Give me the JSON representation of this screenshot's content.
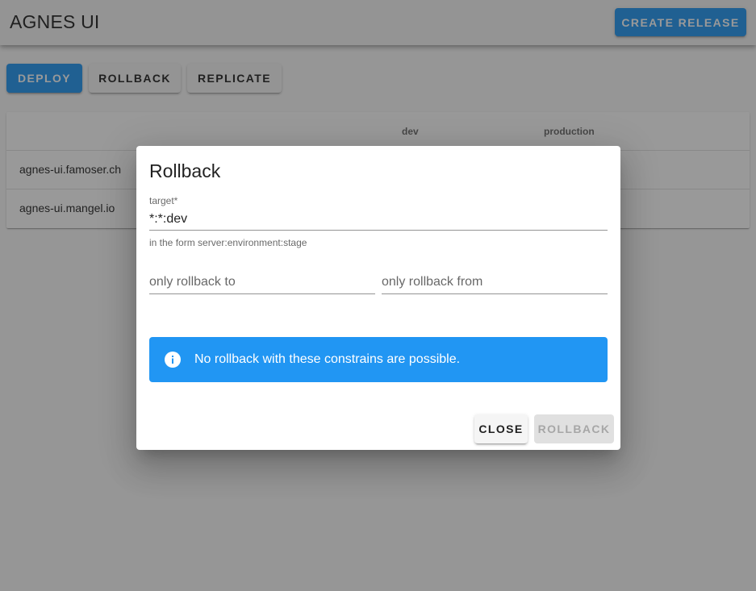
{
  "app": {
    "title": "AGNES UI",
    "create_release_label": "Create Release"
  },
  "actions": {
    "deploy_label": "Deploy",
    "rollback_label": "Rollback",
    "replicate_label": "Replicate"
  },
  "table": {
    "columns": [
      "",
      "dev",
      "production"
    ],
    "rows": [
      {
        "name": "agnes-ui.famoser.ch"
      },
      {
        "name": "agnes-ui.mangel.io"
      }
    ]
  },
  "dialog": {
    "title": "Rollback",
    "target": {
      "label": "target*",
      "value": "*:*:dev",
      "hint": "in the form server:environment:stage"
    },
    "rollback_to": {
      "placeholder": "only rollback to",
      "value": ""
    },
    "rollback_from": {
      "placeholder": "only rollback from",
      "value": ""
    },
    "alert": {
      "icon": "info-icon",
      "message": "No rollback with these constrains are possible."
    },
    "close_label": "Close",
    "rollback_label": "Rollback"
  },
  "colors": {
    "primary": "#2196f3",
    "overlay": "rgba(33,33,33,0.46)"
  }
}
